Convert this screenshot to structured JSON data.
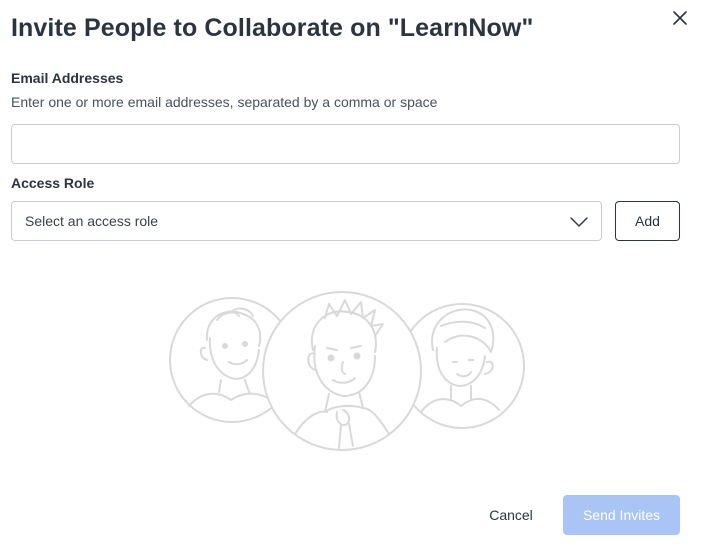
{
  "dialog": {
    "title": "Invite People to Collaborate on \"LearnNow\"",
    "close_icon": "close-icon"
  },
  "email": {
    "label": "Email Addresses",
    "hint": "Enter one or more email addresses, separated by a comma or space",
    "value": "",
    "placeholder": ""
  },
  "role": {
    "label": "Access Role",
    "selected": "Select an access role",
    "chevron_icon": "chevron-down-icon",
    "add_label": "Add"
  },
  "illustration": {
    "icon": "people-illustration"
  },
  "footer": {
    "cancel_label": "Cancel",
    "send_label": "Send Invites",
    "send_disabled": true
  },
  "colors": {
    "text": "#2b3440",
    "border": "#c8ccd2",
    "send_disabled_bg": "#a9c4f5",
    "illustration_stroke": "#d9d9d9"
  }
}
